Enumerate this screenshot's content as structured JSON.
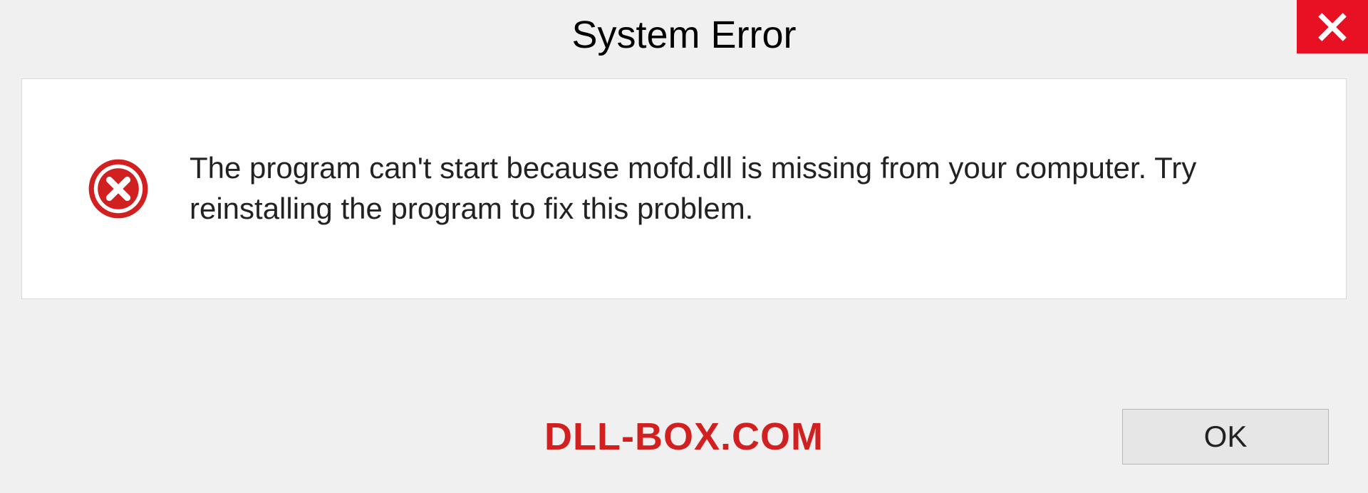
{
  "dialog": {
    "title": "System Error",
    "message": "The program can't start because mofd.dll is missing from your computer. Try reinstalling the program to fix this problem.",
    "ok_label": "OK"
  },
  "watermark": "DLL-BOX.COM",
  "colors": {
    "close_bg": "#e81123",
    "error_red": "#d02020"
  }
}
